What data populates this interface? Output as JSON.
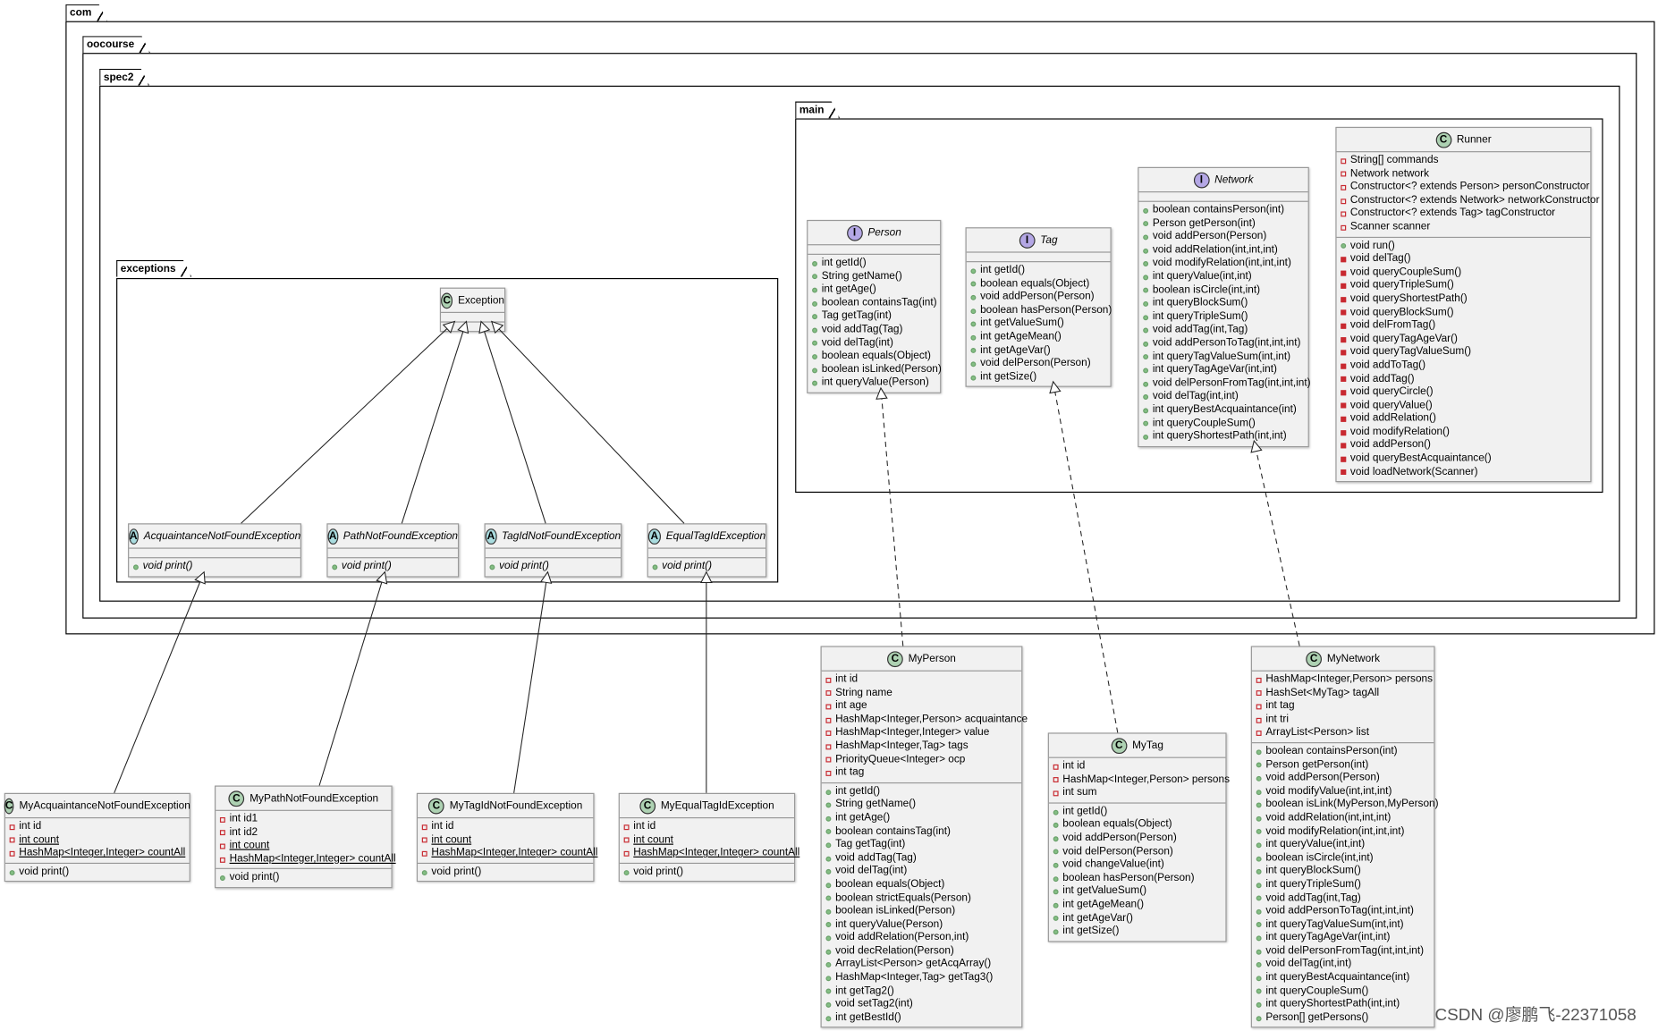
{
  "colors": {
    "class_badge": "#add1b2",
    "interface_badge": "#b4a7e5",
    "abstract_badge": "#a9dcdf",
    "private": "#c82930",
    "public": "#84be84",
    "box_fill": "#f1f1f1"
  },
  "packages": [
    {
      "id": "com",
      "label": "com"
    },
    {
      "id": "oocourse",
      "label": "oocourse"
    },
    {
      "id": "spec2",
      "label": "spec2"
    },
    {
      "id": "main",
      "label": "main"
    },
    {
      "id": "exceptions",
      "label": "exceptions"
    }
  ],
  "classes": [
    {
      "id": "Exception",
      "kind": "C",
      "name": "Exception",
      "fields": [],
      "methods": []
    },
    {
      "id": "Person",
      "kind": "I",
      "name": "Person",
      "fields": [],
      "methods": [
        {
          "vis": "+",
          "text": "int getId()"
        },
        {
          "vis": "+",
          "text": "String getName()"
        },
        {
          "vis": "+",
          "text": "int getAge()"
        },
        {
          "vis": "+",
          "text": "boolean containsTag(int)"
        },
        {
          "vis": "+",
          "text": "Tag getTag(int)"
        },
        {
          "vis": "+",
          "text": "void addTag(Tag)"
        },
        {
          "vis": "+",
          "text": "void delTag(int)"
        },
        {
          "vis": "+",
          "text": "boolean equals(Object)"
        },
        {
          "vis": "+",
          "text": "boolean isLinked(Person)"
        },
        {
          "vis": "+",
          "text": "int queryValue(Person)"
        }
      ]
    },
    {
      "id": "Tag",
      "kind": "I",
      "name": "Tag",
      "fields": [],
      "methods": [
        {
          "vis": "+",
          "text": "int getId()"
        },
        {
          "vis": "+",
          "text": "boolean equals(Object)"
        },
        {
          "vis": "+",
          "text": "void addPerson(Person)"
        },
        {
          "vis": "+",
          "text": "boolean hasPerson(Person)"
        },
        {
          "vis": "+",
          "text": "int getValueSum()"
        },
        {
          "vis": "+",
          "text": "int getAgeMean()"
        },
        {
          "vis": "+",
          "text": "int getAgeVar()"
        },
        {
          "vis": "+",
          "text": "void delPerson(Person)"
        },
        {
          "vis": "+",
          "text": "int getSize()"
        }
      ]
    },
    {
      "id": "Network",
      "kind": "I",
      "name": "Network",
      "fields": [],
      "methods": [
        {
          "vis": "+",
          "text": "boolean containsPerson(int)"
        },
        {
          "vis": "+",
          "text": "Person getPerson(int)"
        },
        {
          "vis": "+",
          "text": "void addPerson(Person)"
        },
        {
          "vis": "+",
          "text": "void addRelation(int,int,int)"
        },
        {
          "vis": "+",
          "text": "void modifyRelation(int,int,int)"
        },
        {
          "vis": "+",
          "text": "int queryValue(int,int)"
        },
        {
          "vis": "+",
          "text": "boolean isCircle(int,int)"
        },
        {
          "vis": "+",
          "text": "int queryBlockSum()"
        },
        {
          "vis": "+",
          "text": "int queryTripleSum()"
        },
        {
          "vis": "+",
          "text": "void addTag(int,Tag)"
        },
        {
          "vis": "+",
          "text": "void addPersonToTag(int,int,int)"
        },
        {
          "vis": "+",
          "text": "int queryTagValueSum(int,int)"
        },
        {
          "vis": "+",
          "text": "int queryTagAgeVar(int,int)"
        },
        {
          "vis": "+",
          "text": "void delPersonFromTag(int,int,int)"
        },
        {
          "vis": "+",
          "text": "void delTag(int,int)"
        },
        {
          "vis": "+",
          "text": "int queryBestAcquaintance(int)"
        },
        {
          "vis": "+",
          "text": "int queryCoupleSum()"
        },
        {
          "vis": "+",
          "text": "int queryShortestPath(int,int)"
        }
      ]
    },
    {
      "id": "Runner",
      "kind": "C",
      "name": "Runner",
      "fields": [
        {
          "vis": "-",
          "text": "String[] commands"
        },
        {
          "vis": "-",
          "text": "Network network"
        },
        {
          "vis": "-",
          "text": "Constructor<? extends Person> personConstructor"
        },
        {
          "vis": "-",
          "text": "Constructor<? extends Network> networkConstructor"
        },
        {
          "vis": "-",
          "text": "Constructor<? extends Tag> tagConstructor"
        },
        {
          "vis": "-",
          "text": "Scanner scanner"
        }
      ],
      "methods": [
        {
          "vis": "+",
          "text": "void run()"
        },
        {
          "vis": "-",
          "text": "void delTag()"
        },
        {
          "vis": "-",
          "text": "void queryCoupleSum()"
        },
        {
          "vis": "-",
          "text": "void queryTripleSum()"
        },
        {
          "vis": "-",
          "text": "void queryShortestPath()"
        },
        {
          "vis": "-",
          "text": "void queryBlockSum()"
        },
        {
          "vis": "-",
          "text": "void delFromTag()"
        },
        {
          "vis": "-",
          "text": "void queryTagAgeVar()"
        },
        {
          "vis": "-",
          "text": "void queryTagValueSum()"
        },
        {
          "vis": "-",
          "text": "void addToTag()"
        },
        {
          "vis": "-",
          "text": "void addTag()"
        },
        {
          "vis": "-",
          "text": "void queryCircle()"
        },
        {
          "vis": "-",
          "text": "void queryValue()"
        },
        {
          "vis": "-",
          "text": "void addRelation()"
        },
        {
          "vis": "-",
          "text": "void modifyRelation()"
        },
        {
          "vis": "-",
          "text": "void addPerson()"
        },
        {
          "vis": "-",
          "text": "void queryBestAcquaintance()"
        },
        {
          "vis": "-",
          "text": "void loadNetwork(Scanner)"
        }
      ]
    },
    {
      "id": "AcquaintanceNotFoundException",
      "kind": "A",
      "name": "AcquaintanceNotFoundException",
      "fields": [],
      "methods": [
        {
          "vis": "+",
          "text": "void print()",
          "abstract": true
        }
      ]
    },
    {
      "id": "PathNotFoundException",
      "kind": "A",
      "name": "PathNotFoundException",
      "fields": [],
      "methods": [
        {
          "vis": "+",
          "text": "void print()",
          "abstract": true
        }
      ]
    },
    {
      "id": "TagIdNotFoundException",
      "kind": "A",
      "name": "TagIdNotFoundException",
      "fields": [],
      "methods": [
        {
          "vis": "+",
          "text": "void print()",
          "abstract": true
        }
      ]
    },
    {
      "id": "EqualTagIdException",
      "kind": "A",
      "name": "EqualTagIdException",
      "fields": [],
      "methods": [
        {
          "vis": "+",
          "text": "void print()",
          "abstract": true
        }
      ]
    },
    {
      "id": "MyPerson",
      "kind": "C",
      "name": "MyPerson",
      "fields": [
        {
          "vis": "-",
          "text": "int id"
        },
        {
          "vis": "-",
          "text": "String name"
        },
        {
          "vis": "-",
          "text": "int age"
        },
        {
          "vis": "-",
          "text": "HashMap<Integer,Person> acquaintance"
        },
        {
          "vis": "-",
          "text": "HashMap<Integer,Integer> value"
        },
        {
          "vis": "-",
          "text": "HashMap<Integer,Tag> tags"
        },
        {
          "vis": "-",
          "text": "PriorityQueue<Integer> ocp"
        },
        {
          "vis": "-",
          "text": "int tag"
        }
      ],
      "methods": [
        {
          "vis": "+",
          "text": "int getId()"
        },
        {
          "vis": "+",
          "text": "String getName()"
        },
        {
          "vis": "+",
          "text": "int getAge()"
        },
        {
          "vis": "+",
          "text": "boolean containsTag(int)"
        },
        {
          "vis": "+",
          "text": "Tag getTag(int)"
        },
        {
          "vis": "+",
          "text": "void addTag(Tag)"
        },
        {
          "vis": "+",
          "text": "void delTag(int)"
        },
        {
          "vis": "+",
          "text": "boolean equals(Object)"
        },
        {
          "vis": "+",
          "text": "boolean strictEquals(Person)"
        },
        {
          "vis": "+",
          "text": "boolean isLinked(Person)"
        },
        {
          "vis": "+",
          "text": "int queryValue(Person)"
        },
        {
          "vis": "+",
          "text": "void addRelation(Person,int)"
        },
        {
          "vis": "+",
          "text": "void decRelation(Person)"
        },
        {
          "vis": "+",
          "text": "ArrayList<Person> getAcqArray()"
        },
        {
          "vis": "+",
          "text": "HashMap<Integer,Tag> getTag3()"
        },
        {
          "vis": "+",
          "text": "int getTag2()"
        },
        {
          "vis": "+",
          "text": "void setTag2(int)"
        },
        {
          "vis": "+",
          "text": "int getBestId()"
        }
      ]
    },
    {
      "id": "MyTag",
      "kind": "C",
      "name": "MyTag",
      "fields": [
        {
          "vis": "-",
          "text": "int id"
        },
        {
          "vis": "-",
          "text": "HashMap<Integer,Person> persons"
        },
        {
          "vis": "-",
          "text": "int sum"
        }
      ],
      "methods": [
        {
          "vis": "+",
          "text": "int getId()"
        },
        {
          "vis": "+",
          "text": "boolean equals(Object)"
        },
        {
          "vis": "+",
          "text": "void addPerson(Person)"
        },
        {
          "vis": "+",
          "text": "void delPerson(Person)"
        },
        {
          "vis": "+",
          "text": "void changeValue(int)"
        },
        {
          "vis": "+",
          "text": "boolean hasPerson(Person)"
        },
        {
          "vis": "+",
          "text": "int getValueSum()"
        },
        {
          "vis": "+",
          "text": "int getAgeMean()"
        },
        {
          "vis": "+",
          "text": "int getAgeVar()"
        },
        {
          "vis": "+",
          "text": "int getSize()"
        }
      ]
    },
    {
      "id": "MyNetwork",
      "kind": "C",
      "name": "MyNetwork",
      "fields": [
        {
          "vis": "-",
          "text": "HashMap<Integer,Person> persons"
        },
        {
          "vis": "-",
          "text": "HashSet<MyTag> tagAll"
        },
        {
          "vis": "-",
          "text": "int tag"
        },
        {
          "vis": "-",
          "text": "int tri"
        },
        {
          "vis": "-",
          "text": "ArrayList<Person> list"
        }
      ],
      "methods": [
        {
          "vis": "+",
          "text": "boolean containsPerson(int)"
        },
        {
          "vis": "+",
          "text": "Person getPerson(int)"
        },
        {
          "vis": "+",
          "text": "void addPerson(Person)"
        },
        {
          "vis": "+",
          "text": "void modifyValue(int,int,int)"
        },
        {
          "vis": "+",
          "text": "boolean isLink(MyPerson,MyPerson)"
        },
        {
          "vis": "+",
          "text": "void addRelation(int,int,int)"
        },
        {
          "vis": "+",
          "text": "void modifyRelation(int,int,int)"
        },
        {
          "vis": "+",
          "text": "int queryValue(int,int)"
        },
        {
          "vis": "+",
          "text": "boolean isCircle(int,int)"
        },
        {
          "vis": "+",
          "text": "int queryBlockSum()"
        },
        {
          "vis": "+",
          "text": "int queryTripleSum()"
        },
        {
          "vis": "+",
          "text": "void addTag(int,Tag)"
        },
        {
          "vis": "+",
          "text": "void addPersonToTag(int,int,int)"
        },
        {
          "vis": "+",
          "text": "int queryTagValueSum(int,int)"
        },
        {
          "vis": "+",
          "text": "int queryTagAgeVar(int,int)"
        },
        {
          "vis": "+",
          "text": "void delPersonFromTag(int,int,int)"
        },
        {
          "vis": "+",
          "text": "void delTag(int,int)"
        },
        {
          "vis": "+",
          "text": "int queryBestAcquaintance(int)"
        },
        {
          "vis": "+",
          "text": "int queryCoupleSum()"
        },
        {
          "vis": "+",
          "text": "int queryShortestPath(int,int)"
        },
        {
          "vis": "+",
          "text": "Person[] getPersons()"
        }
      ]
    },
    {
      "id": "MyAcquaintanceNotFoundException",
      "kind": "C",
      "name": "MyAcquaintanceNotFoundException",
      "fields": [
        {
          "vis": "-",
          "text": "int id"
        },
        {
          "vis": "-",
          "text": "int count",
          "static": true
        },
        {
          "vis": "-",
          "text": "HashMap<Integer,Integer> countAll",
          "static": true
        }
      ],
      "methods": [
        {
          "vis": "+",
          "text": "void print()"
        }
      ]
    },
    {
      "id": "MyPathNotFoundException",
      "kind": "C",
      "name": "MyPathNotFoundException",
      "fields": [
        {
          "vis": "-",
          "text": "int id1"
        },
        {
          "vis": "-",
          "text": "int id2"
        },
        {
          "vis": "-",
          "text": "int count",
          "static": true
        },
        {
          "vis": "-",
          "text": "HashMap<Integer,Integer> countAll",
          "static": true
        }
      ],
      "methods": [
        {
          "vis": "+",
          "text": "void print()"
        }
      ]
    },
    {
      "id": "MyTagIdNotFoundException",
      "kind": "C",
      "name": "MyTagIdNotFoundException",
      "fields": [
        {
          "vis": "-",
          "text": "int id"
        },
        {
          "vis": "-",
          "text": "int count",
          "static": true
        },
        {
          "vis": "-",
          "text": "HashMap<Integer,Integer> countAll",
          "static": true
        }
      ],
      "methods": [
        {
          "vis": "+",
          "text": "void print()"
        }
      ]
    },
    {
      "id": "MyEqualTagIdException",
      "kind": "C",
      "name": "MyEqualTagIdException",
      "fields": [
        {
          "vis": "-",
          "text": "int id"
        },
        {
          "vis": "-",
          "text": "int count",
          "static": true
        },
        {
          "vis": "-",
          "text": "HashMap<Integer,Integer> countAll",
          "static": true
        }
      ],
      "methods": [
        {
          "vis": "+",
          "text": "void print()"
        }
      ]
    }
  ],
  "relations": [
    {
      "from": "AcquaintanceNotFoundException",
      "to": "Exception",
      "type": "extends"
    },
    {
      "from": "PathNotFoundException",
      "to": "Exception",
      "type": "extends"
    },
    {
      "from": "TagIdNotFoundException",
      "to": "Exception",
      "type": "extends"
    },
    {
      "from": "EqualTagIdException",
      "to": "Exception",
      "type": "extends"
    },
    {
      "from": "MyAcquaintanceNotFoundException",
      "to": "AcquaintanceNotFoundException",
      "type": "extends"
    },
    {
      "from": "MyPathNotFoundException",
      "to": "PathNotFoundException",
      "type": "extends"
    },
    {
      "from": "MyTagIdNotFoundException",
      "to": "TagIdNotFoundException",
      "type": "extends"
    },
    {
      "from": "MyEqualTagIdException",
      "to": "EqualTagIdException",
      "type": "extends"
    },
    {
      "from": "MyPerson",
      "to": "Person",
      "type": "implements"
    },
    {
      "from": "MyTag",
      "to": "Tag",
      "type": "implements"
    },
    {
      "from": "MyNetwork",
      "to": "Network",
      "type": "implements"
    }
  ],
  "watermark": "CSDN @廖鹏飞-22371058"
}
